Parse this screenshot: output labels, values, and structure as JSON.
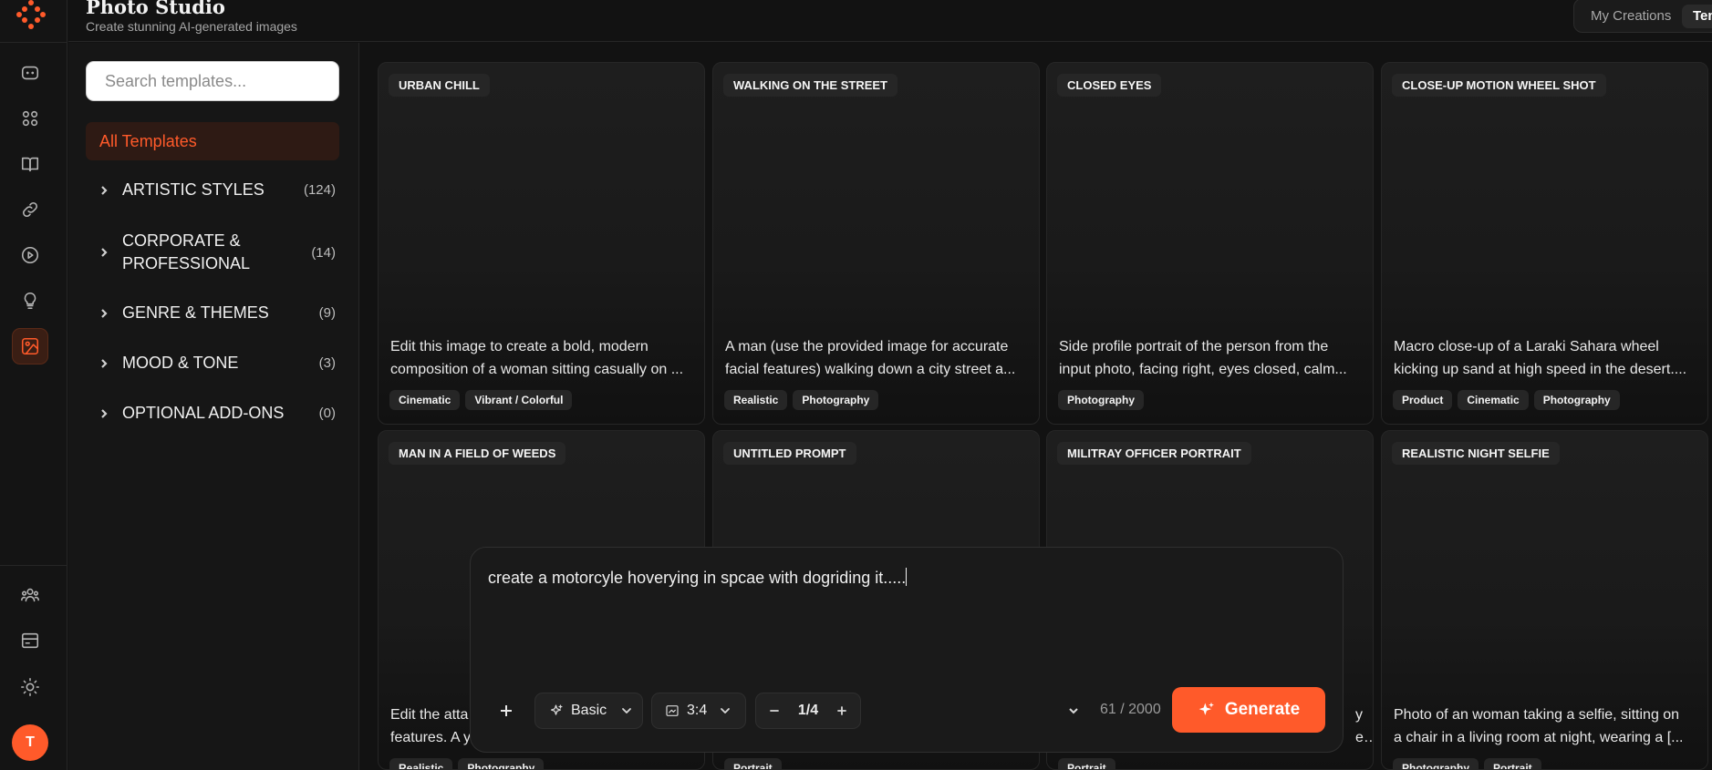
{
  "app": {
    "title": "Photo Studio",
    "subtitle": "Create stunning AI-generated images"
  },
  "header_tabs": [
    {
      "label": "My Creations",
      "active": false
    },
    {
      "label": "Templates",
      "active": true
    }
  ],
  "rail": {
    "icons": [
      "chat-icon",
      "apps-icon",
      "book-icon",
      "link-icon",
      "play-icon",
      "lightbulb-icon",
      "image-icon"
    ],
    "active_icon": "image-icon",
    "bottom_icons": [
      "team-icon",
      "billing-icon",
      "theme-icon"
    ],
    "avatar_initial": "T"
  },
  "sidebar": {
    "search_placeholder": "Search templates...",
    "all_label": "All Templates",
    "categories": [
      {
        "label": "ARTISTIC STYLES",
        "count": "(124)"
      },
      {
        "label": "CORPORATE & PROFESSIONAL",
        "count": "(14)"
      },
      {
        "label": "GENRE & THEMES",
        "count": "(9)"
      },
      {
        "label": "MOOD & TONE",
        "count": "(3)"
      },
      {
        "label": "OPTIONAL ADD-ONS",
        "count": "(0)"
      }
    ]
  },
  "cards": [
    {
      "title": "URBAN CHILL",
      "desc1": "Edit this image to create a bold, modern",
      "desc2": "composition of a woman sitting casually on ...",
      "tags": [
        "Cinematic",
        "Vibrant / Colorful"
      ]
    },
    {
      "title": "WALKING ON THE STREET",
      "desc1": "A man (use the provided image for accurate",
      "desc2": "facial features) walking down a city street a...",
      "tags": [
        "Realistic",
        "Photography"
      ]
    },
    {
      "title": "CLOSED EYES",
      "desc1": "Side profile portrait of the person from the",
      "desc2": "input photo, facing right, eyes closed, calm...",
      "tags": [
        "Photography"
      ]
    },
    {
      "title": "CLOSE-UP MOTION WHEEL SHOT",
      "desc1": "Macro close-up of a Laraki Sahara wheel",
      "desc2": "kicking up sand at high speed in the desert....",
      "tags": [
        "Product",
        "Cinematic",
        "Photography"
      ]
    },
    {
      "title": "MAN IN A FIELD OF WEEDS",
      "desc1": "Edit the atta",
      "desc2": "features. A y",
      "tags": [
        "Realistic",
        "Photography"
      ]
    },
    {
      "title": "UNTITLED PROMPT",
      "desc1": "",
      "desc2": "",
      "tags": [
        "Portrait"
      ]
    },
    {
      "title": "MILITRAY OFFICER PORTRAIT",
      "desc1": "y",
      "desc2": "e...",
      "tags": [
        "Portrait"
      ]
    },
    {
      "title": "REALISTIC NIGHT SELFIE",
      "desc1": "Photo of an woman taking a selfie, sitting on",
      "desc2": "a chair in a living room at night, wearing a [...",
      "tags": [
        "Photography",
        "Portrait"
      ]
    }
  ],
  "composer": {
    "prompt": "create a motorcyle hoverying in spcae with dogriding it.....",
    "quality": "Basic",
    "aspect_ratio": "3:4",
    "count": "1/4",
    "char_count": "61 / 2000",
    "generate_label": "Generate"
  },
  "colors": {
    "accent": "#ff5a2a",
    "background": "#121212",
    "card": "#1c1c1c"
  }
}
